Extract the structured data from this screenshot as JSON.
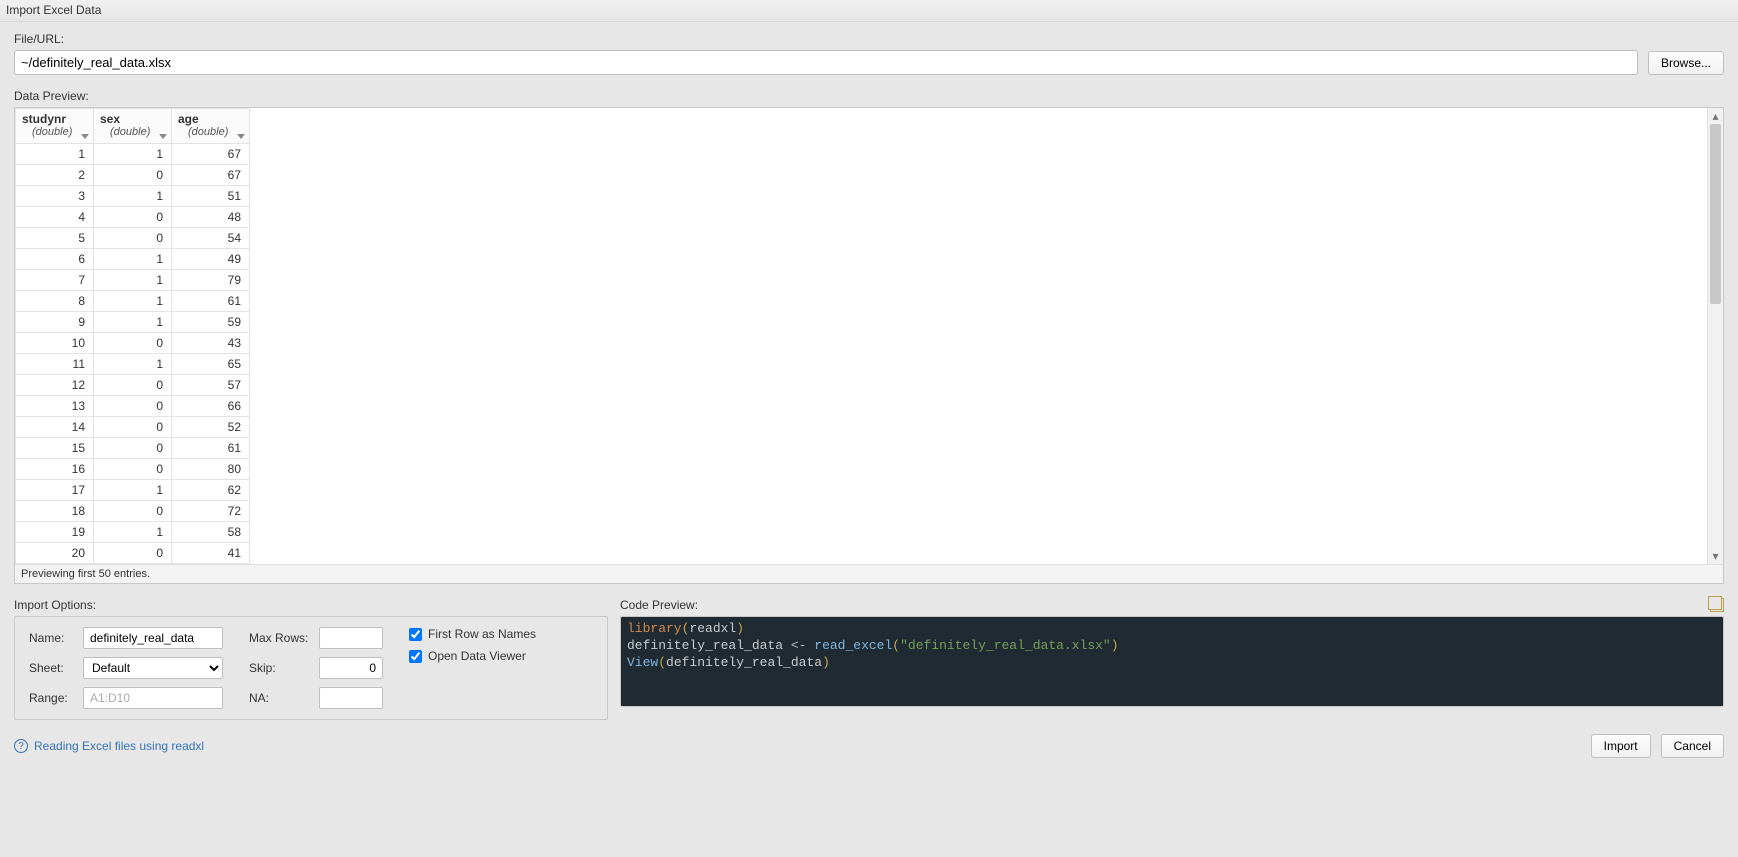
{
  "window_title": "Import Excel Data",
  "file_section": {
    "label": "File/URL:",
    "path": "~/definitely_real_data.xlsx",
    "browse_label": "Browse..."
  },
  "preview": {
    "label": "Data Preview:",
    "columns": [
      {
        "name": "studynr",
        "type": "(double)"
      },
      {
        "name": "sex",
        "type": "(double)"
      },
      {
        "name": "age",
        "type": "(double)"
      }
    ],
    "rows": [
      [
        1,
        1,
        67
      ],
      [
        2,
        0,
        67
      ],
      [
        3,
        1,
        51
      ],
      [
        4,
        0,
        48
      ],
      [
        5,
        0,
        54
      ],
      [
        6,
        1,
        49
      ],
      [
        7,
        1,
        79
      ],
      [
        8,
        1,
        61
      ],
      [
        9,
        1,
        59
      ],
      [
        10,
        0,
        43
      ],
      [
        11,
        1,
        65
      ],
      [
        12,
        0,
        57
      ],
      [
        13,
        0,
        66
      ],
      [
        14,
        0,
        52
      ],
      [
        15,
        0,
        61
      ],
      [
        16,
        0,
        80
      ],
      [
        17,
        1,
        62
      ],
      [
        18,
        0,
        72
      ],
      [
        19,
        1,
        58
      ],
      [
        20,
        0,
        41
      ]
    ],
    "footer": "Previewing first 50 entries."
  },
  "options": {
    "heading": "Import Options:",
    "name_label": "Name:",
    "name_value": "definitely_real_data",
    "sheet_label": "Sheet:",
    "sheet_value": "Default",
    "range_label": "Range:",
    "range_placeholder": "A1:D10",
    "maxrows_label": "Max Rows:",
    "maxrows_value": "",
    "skip_label": "Skip:",
    "skip_value": "0",
    "na_label": "NA:",
    "na_value": "",
    "first_row_label": "First Row as Names",
    "open_viewer_label": "Open Data Viewer"
  },
  "code": {
    "heading": "Code Preview:",
    "kw_library": "library",
    "pkg": "readxl",
    "var": "definitely_real_data",
    "arrow": "<-",
    "fn_read": "read_excel",
    "str_arg": "\"definitely_real_data.xlsx\"",
    "fn_view": "View"
  },
  "help": {
    "text": "Reading Excel files using readxl"
  },
  "buttons": {
    "import": "Import",
    "cancel": "Cancel"
  }
}
